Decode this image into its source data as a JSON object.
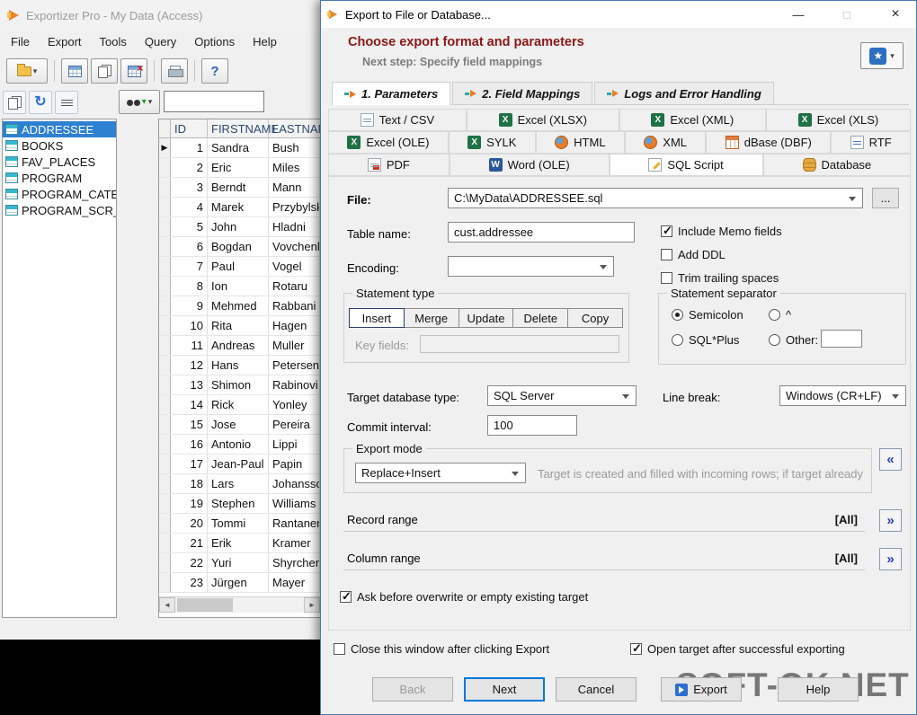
{
  "watermark": "SOFT-OK.NET",
  "icons": {
    "minimize": "—",
    "maximize": "□",
    "close": "×",
    "star": "★",
    "dropdown": "▾",
    "collapse": "«",
    "expand": "»",
    "row_marker": "▶",
    "scroll_left": "◄",
    "scroll_right": "►",
    "refresh": "↻",
    "help": "?",
    "filter_x": "×",
    "find_arrow": "▾"
  },
  "main_window": {
    "title": "Exportizer Pro - My Data (Access)",
    "menu_items": [
      "File",
      "Export",
      "Tools",
      "Query",
      "Options",
      "Help"
    ],
    "table_list": {
      "items": [
        "ADDRESSEE",
        "BOOKS",
        "FAV_PLACES",
        "PROGRAM",
        "PROGRAM_CATEGORY",
        "PROGRAM_SCR_SHOT"
      ],
      "selected": "ADDRESSEE"
    },
    "grid": {
      "columns": [
        "ID",
        "FIRSTNAME",
        "LASTNAME"
      ],
      "rows": [
        [
          "1",
          "Sandra",
          "Bush"
        ],
        [
          "2",
          "Eric",
          "Miles"
        ],
        [
          "3",
          "Berndt",
          "Mann"
        ],
        [
          "4",
          "Marek",
          "Przybylsk"
        ],
        [
          "5",
          "John",
          "Hladni"
        ],
        [
          "6",
          "Bogdan",
          "Vovchenk"
        ],
        [
          "7",
          "Paul",
          "Vogel"
        ],
        [
          "8",
          "Ion",
          "Rotaru"
        ],
        [
          "9",
          "Mehmed",
          "Rabbani"
        ],
        [
          "10",
          "Rita",
          "Hagen"
        ],
        [
          "11",
          "Andreas",
          "Muller"
        ],
        [
          "12",
          "Hans",
          "Petersen"
        ],
        [
          "13",
          "Shimon",
          "Rabinovi"
        ],
        [
          "14",
          "Rick",
          "Yonley"
        ],
        [
          "15",
          "Jose",
          "Pereira"
        ],
        [
          "16",
          "Antonio",
          "Lippi"
        ],
        [
          "17",
          "Jean-Paul",
          "Papin"
        ],
        [
          "18",
          "Lars",
          "Johansso"
        ],
        [
          "19",
          "Stephen",
          "Williams"
        ],
        [
          "20",
          "Tommi",
          "Rantanen"
        ],
        [
          "21",
          "Erik",
          "Kramer"
        ],
        [
          "22",
          "Yuri",
          "Shyrchen"
        ],
        [
          "23",
          "Jürgen",
          "Mayer"
        ]
      ]
    }
  },
  "dialog": {
    "title": "Export to File or Database...",
    "header": "Choose export format and parameters",
    "subheader": "Next step: Specify field mappings",
    "step_tabs": [
      {
        "label": "1. Parameters",
        "active": true
      },
      {
        "label": "2. Field Mappings",
        "active": false
      },
      {
        "label": "Logs and Error Handling",
        "active": false
      }
    ],
    "format_tabs": [
      [
        {
          "label": "Text / CSV",
          "icon": "text-csv"
        },
        {
          "label": "Excel (XLSX)",
          "icon": "excel"
        },
        {
          "label": "Excel (XML)",
          "icon": "excel"
        },
        {
          "label": "Excel (XLS)",
          "icon": "excel"
        }
      ],
      [
        {
          "label": "Excel (OLE)",
          "icon": "excel"
        },
        {
          "label": "SYLK",
          "icon": "excel"
        },
        {
          "label": "HTML",
          "icon": "globe"
        },
        {
          "label": "XML",
          "icon": "globe"
        },
        {
          "label": "dBase (DBF)",
          "icon": "dbase"
        },
        {
          "label": "RTF",
          "icon": "rtf"
        }
      ],
      [
        {
          "label": "PDF",
          "icon": "pdf"
        },
        {
          "label": "Word (OLE)",
          "icon": "word"
        },
        {
          "label": "SQL Script",
          "icon": "sql",
          "selected": true
        },
        {
          "label": "Database",
          "icon": "database"
        }
      ]
    ],
    "fields": {
      "file_label": "File:",
      "file_value": "C:\\MyData\\ADDRESSEE.sql",
      "browse_label": "...",
      "table_name_label": "Table name:",
      "table_name_value": "cust.addressee",
      "encoding_label": "Encoding:",
      "include_memo_label": "Include Memo fields",
      "add_ddl_label": "Add DDL",
      "trim_spaces_label": "Trim trailing spaces",
      "statement_type_legend": "Statement type",
      "statement_buttons": [
        "Insert",
        "Merge",
        "Update",
        "Delete",
        "Copy"
      ],
      "statement_selected": "Insert",
      "key_fields_label": "Key fields:",
      "statement_separator_legend": "Statement separator",
      "semicolon_label": "Semicolon",
      "caret_label": "^",
      "sqlplus_label": "SQL*Plus",
      "other_label": "Other:",
      "target_db_label": "Target database type:",
      "target_db_value": "SQL Server",
      "line_break_label": "Line break:",
      "line_break_value": "Windows (CR+LF)",
      "commit_interval_label": "Commit interval:",
      "commit_interval_value": "100",
      "export_mode_legend": "Export mode",
      "export_mode_value": "Replace+Insert",
      "export_mode_note": "Target is created and filled with incoming rows; if target already…",
      "record_range_label": "Record range",
      "record_range_value": "[All]",
      "column_range_label": "Column range",
      "column_range_value": "[All]",
      "ask_overwrite_label": "Ask before overwrite or empty existing target"
    },
    "footer": {
      "close_after_label": "Close this window after clicking Export",
      "open_target_label": "Open target after successful exporting",
      "back_label": "Back",
      "next_label": "Next",
      "cancel_label": "Cancel",
      "export_label": "Export",
      "help_label": "Help"
    }
  }
}
